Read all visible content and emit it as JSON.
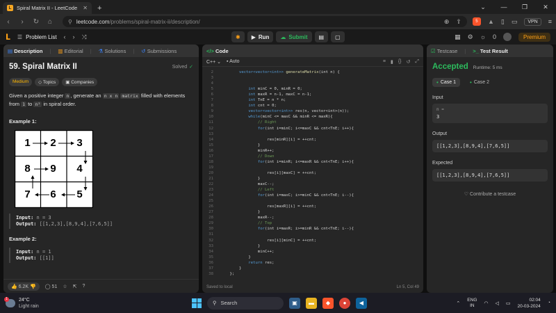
{
  "browser": {
    "tab_title": "Spiral Matrix II - LeetCode",
    "tab_close": "✕",
    "new_tab": "+",
    "url_host": "leetcode.com",
    "url_path": "/problems/spiral-matrix-ii/description/",
    "vpn_label": "VPN",
    "brave_badge": "5"
  },
  "header": {
    "problem_list": "Problem List",
    "run": "Run",
    "submit": "Submit",
    "coins": "0",
    "premium": "Premium"
  },
  "desc_tabs": [
    "Description",
    "Editorial",
    "Solutions",
    "Submissions"
  ],
  "problem": {
    "title": "59. Spiral Matrix II",
    "solved": "Solved",
    "tags": [
      "Medium",
      "Topics",
      "Companies"
    ],
    "text_1": "Given a positive integer ",
    "code_n": "n",
    "text_2": ", generate an ",
    "code_nxn": "n x n",
    "code_matrix": "matrix",
    "text_3": " filled with elements from ",
    "code_1": "1",
    "text_4": " to",
    "code_n2": "n²",
    "text_5": " in spiral order.",
    "example1_title": "Example 1:",
    "matrix": [
      [
        "1",
        "2",
        "3"
      ],
      [
        "8",
        "9",
        "4"
      ],
      [
        "7",
        "6",
        "5"
      ]
    ],
    "ex1_input_label": "Input:",
    "ex1_input_value": "n = 3",
    "ex1_output_label": "Output:",
    "ex1_output_value": "[[1,2,3],[8,9,4],[7,6,5]]",
    "example2_title": "Example 2:",
    "ex2_input_label": "Input:",
    "ex2_input_value": "n = 1",
    "ex2_output_label": "Output:",
    "ex2_output_value": "[[1]]"
  },
  "desc_footer": {
    "likes": "6.2K",
    "comments": "51"
  },
  "code_panel": {
    "tab": "Code",
    "language": "C++",
    "auto": "Auto",
    "saved": "Saved to local",
    "cursor": "Ln 5, Col 49",
    "lines": [
      {
        "n": "2",
        "t": [
          [
            "        ",
            ""
          ],
          [
            "vector<vector<int>> ",
            "kw"
          ],
          [
            "generateMatrix",
            "fn"
          ],
          [
            "(int n) {",
            ""
          ]
        ]
      },
      {
        "n": "3",
        "t": [
          [
            "",
            ""
          ]
        ]
      },
      {
        "n": "4",
        "t": [
          [
            "",
            ""
          ]
        ]
      },
      {
        "n": "5",
        "t": [
          [
            "            ",
            ""
          ],
          [
            "int ",
            "kw"
          ],
          [
            "minC = 0, minR = 0;",
            ""
          ]
        ]
      },
      {
        "n": "6",
        "t": [
          [
            "            ",
            ""
          ],
          [
            "int ",
            "kw"
          ],
          [
            "maxR = n-1, maxC = n-1;",
            ""
          ]
        ]
      },
      {
        "n": "7",
        "t": [
          [
            "            ",
            ""
          ],
          [
            "int ",
            "kw"
          ],
          [
            "TnE = n * n;",
            ""
          ]
        ]
      },
      {
        "n": "8",
        "t": [
          [
            "            ",
            ""
          ],
          [
            "int ",
            "kw"
          ],
          [
            "cnt = 0;",
            ""
          ]
        ]
      },
      {
        "n": "9",
        "t": [
          [
            "            ",
            ""
          ],
          [
            "vector<vector<int>> ",
            "kw"
          ],
          [
            "res(n, vector<int>(n));",
            ""
          ]
        ]
      },
      {
        "n": "10",
        "t": [
          [
            "            ",
            ""
          ],
          [
            "while",
            "kw"
          ],
          [
            "(minC <= maxC && minR <= maxR){",
            ""
          ]
        ]
      },
      {
        "n": "11",
        "t": [
          [
            "                ",
            ""
          ],
          [
            "// Right",
            "cm"
          ]
        ]
      },
      {
        "n": "12",
        "t": [
          [
            "                ",
            ""
          ],
          [
            "for",
            "kw"
          ],
          [
            "(int i=minC; i<=maxC && cnt<TnE; i++){",
            ""
          ]
        ]
      },
      {
        "n": "13",
        "t": [
          [
            "",
            ""
          ]
        ]
      },
      {
        "n": "14",
        "t": [
          [
            "                    ",
            ""
          ],
          [
            "res[minR][i] = ++cnt;",
            ""
          ]
        ]
      },
      {
        "n": "15",
        "t": [
          [
            "                ",
            ""
          ],
          [
            "}",
            ""
          ]
        ]
      },
      {
        "n": "16",
        "t": [
          [
            "                ",
            ""
          ],
          [
            "minR++;",
            ""
          ]
        ]
      },
      {
        "n": "17",
        "t": [
          [
            "                ",
            ""
          ],
          [
            "// Down",
            "cm"
          ]
        ]
      },
      {
        "n": "18",
        "t": [
          [
            "                ",
            ""
          ],
          [
            "for",
            "kw"
          ],
          [
            "(int i=minR; i<=maxR && cnt<TnE; i++){",
            ""
          ]
        ]
      },
      {
        "n": "19",
        "t": [
          [
            "",
            ""
          ]
        ]
      },
      {
        "n": "20",
        "t": [
          [
            "                    ",
            ""
          ],
          [
            "res[i][maxC] = ++cnt;",
            ""
          ]
        ]
      },
      {
        "n": "21",
        "t": [
          [
            "                ",
            ""
          ],
          [
            "}",
            ""
          ]
        ]
      },
      {
        "n": "22",
        "t": [
          [
            "                ",
            ""
          ],
          [
            "maxC--;",
            ""
          ]
        ]
      },
      {
        "n": "23",
        "t": [
          [
            "                ",
            ""
          ],
          [
            "// Left",
            "cm"
          ]
        ]
      },
      {
        "n": "24",
        "t": [
          [
            "                ",
            ""
          ],
          [
            "for",
            "kw"
          ],
          [
            "(int i=maxC; i>=minC && cnt<TnE; i--){",
            ""
          ]
        ]
      },
      {
        "n": "25",
        "t": [
          [
            "",
            ""
          ]
        ]
      },
      {
        "n": "26",
        "t": [
          [
            "                    ",
            ""
          ],
          [
            "res[maxR][i] = ++cnt;",
            ""
          ]
        ]
      },
      {
        "n": "27",
        "t": [
          [
            "                ",
            ""
          ],
          [
            "}",
            ""
          ]
        ]
      },
      {
        "n": "28",
        "t": [
          [
            "                ",
            ""
          ],
          [
            "maxR--;",
            ""
          ]
        ]
      },
      {
        "n": "29",
        "t": [
          [
            "                ",
            ""
          ],
          [
            "// Top",
            "cm"
          ]
        ]
      },
      {
        "n": "30",
        "t": [
          [
            "                ",
            ""
          ],
          [
            "for",
            "kw"
          ],
          [
            "(int i=maxR; i>=minR && cnt<TnE; i--){",
            ""
          ]
        ]
      },
      {
        "n": "31",
        "t": [
          [
            "",
            ""
          ]
        ]
      },
      {
        "n": "32",
        "t": [
          [
            "                    ",
            ""
          ],
          [
            "res[i][minC] = ++cnt;",
            ""
          ]
        ]
      },
      {
        "n": "33",
        "t": [
          [
            "                ",
            ""
          ],
          [
            "}",
            ""
          ]
        ]
      },
      {
        "n": "34",
        "t": [
          [
            "                ",
            ""
          ],
          [
            "minC++;",
            ""
          ]
        ]
      },
      {
        "n": "35",
        "t": [
          [
            "            ",
            ""
          ],
          [
            "}",
            ""
          ]
        ]
      },
      {
        "n": "36",
        "t": [
          [
            "            ",
            ""
          ],
          [
            "return ",
            "kw"
          ],
          [
            "res;",
            ""
          ]
        ]
      },
      {
        "n": "37",
        "t": [
          [
            "        ",
            ""
          ],
          [
            "}",
            ""
          ]
        ]
      },
      {
        "n": "38",
        "t": [
          [
            "    ",
            ""
          ],
          [
            "};",
            ""
          ]
        ]
      }
    ]
  },
  "result_tabs": [
    "Testcase",
    "Test Result"
  ],
  "result": {
    "status": "Accepted",
    "runtime": "Runtime: 5 ms",
    "cases": [
      "Case 1",
      "Case 2"
    ],
    "input_label": "Input",
    "input_key": "n =",
    "input_value": "3",
    "output_label": "Output",
    "output_value": "[[1,2,3],[8,9,4],[7,6,5]]",
    "expected_label": "Expected",
    "expected_value": "[[1,2,3],[8,9,4],[7,6,5]]",
    "contribute": "Contribute a testcase"
  },
  "taskbar": {
    "temp": "24°C",
    "weather": "Light rain",
    "search": "Search",
    "lang_top": "ENG",
    "lang_bottom": "IN",
    "time": "02:04",
    "date": "20-03-2024"
  },
  "colors": {
    "accent_orange": "#ffa116",
    "accepted_green": "#2cbb5d",
    "medium_yellow": "#ffb800"
  }
}
